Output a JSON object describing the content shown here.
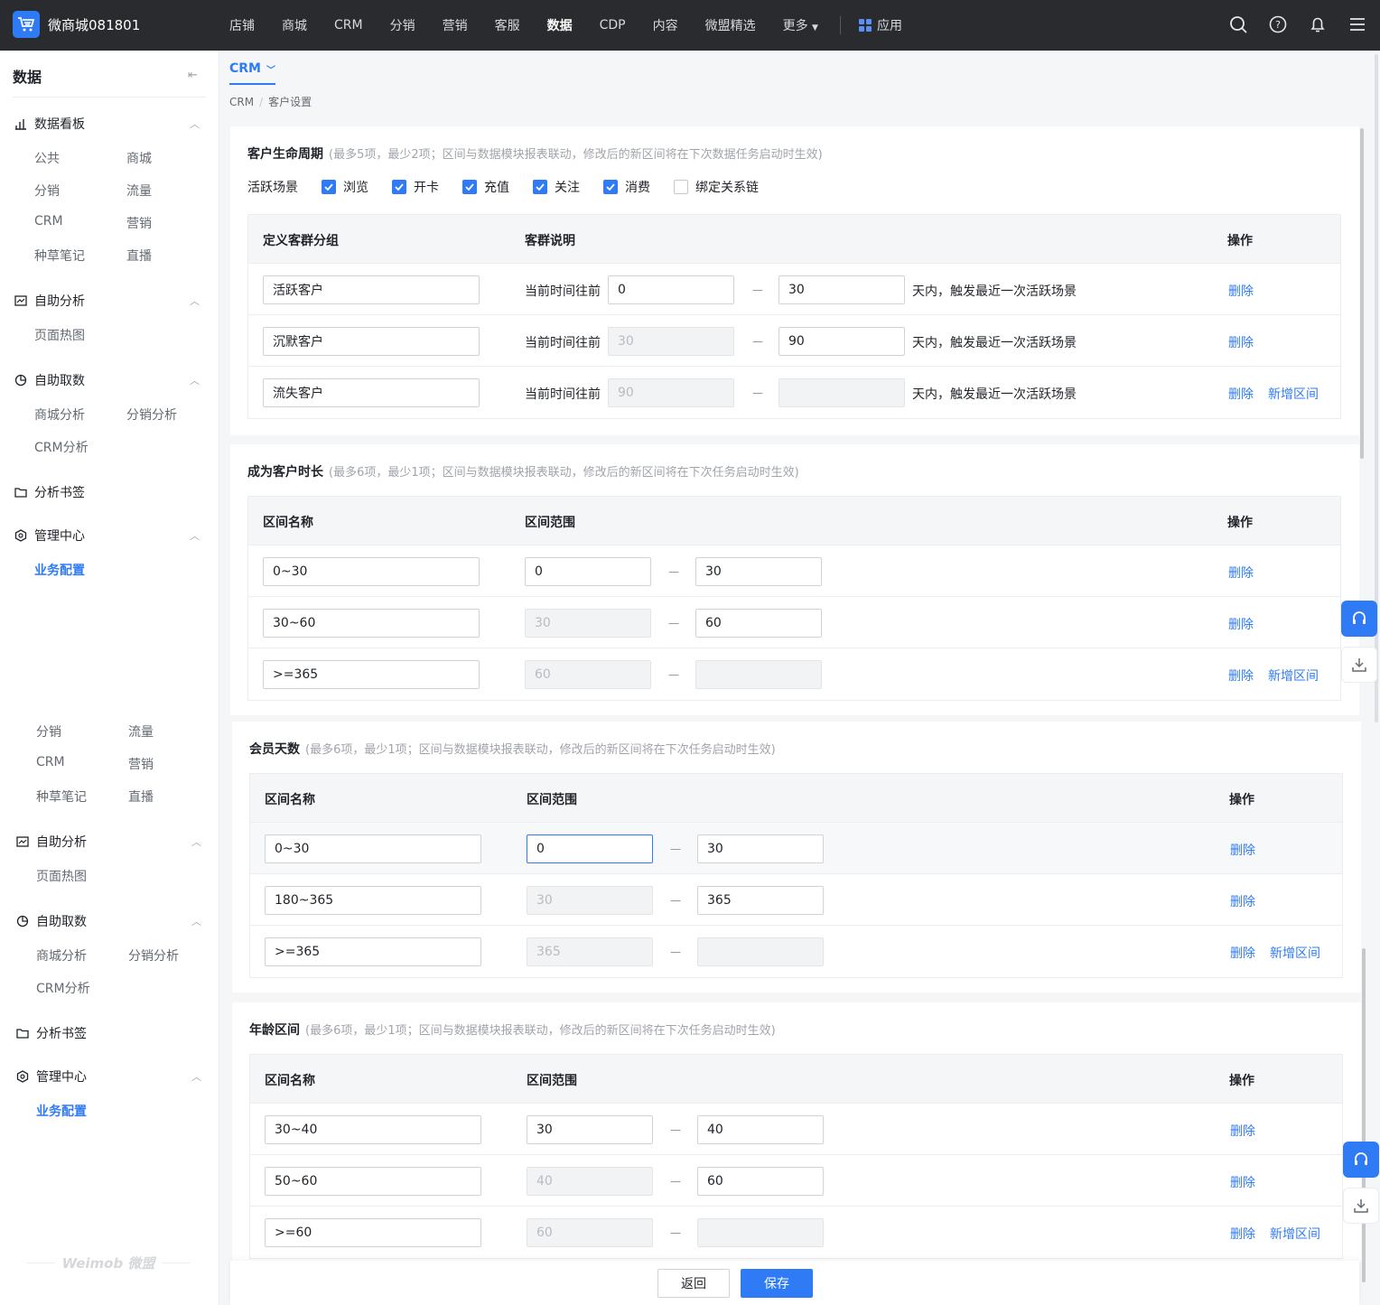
{
  "topbar": {
    "brand": "微商城081801",
    "nav": [
      "店铺",
      "商城",
      "CRM",
      "分销",
      "营销",
      "客服",
      "数据",
      "CDP",
      "内容",
      "微盟精选"
    ],
    "more": "更多",
    "apps": "应用",
    "active": "数据"
  },
  "sidebar": {
    "title": "数据",
    "dashboard": "数据看板",
    "dashboard_items": [
      "公共",
      "商城",
      "分销",
      "流量",
      "CRM",
      "营销",
      "种草笔记",
      "直播"
    ],
    "self_analysis": "自助分析",
    "heatmap": "页面热图",
    "self_fetch": "自助取数",
    "fetch_items": [
      "商城分析",
      "分销分析",
      "CRM分析"
    ],
    "bookmark": "分析书签",
    "manage": "管理中心",
    "biz_config": "业务配置",
    "watermark": "Weimob 微盟"
  },
  "header": {
    "tab": "CRM",
    "crumb_root": "CRM",
    "crumb_current": "客户设置"
  },
  "lifecycle": {
    "title": "客户生命周期",
    "hint": "(最多5项，最少2项；区间与数据模块报表联动，修改后的新区间将在下次数据任务启动时生效)",
    "scene_label": "活跃场景",
    "scenes": [
      {
        "label": "浏览",
        "checked": true
      },
      {
        "label": "开卡",
        "checked": true
      },
      {
        "label": "充值",
        "checked": true
      },
      {
        "label": "关注",
        "checked": true
      },
      {
        "label": "消费",
        "checked": true
      },
      {
        "label": "绑定关系链",
        "checked": false
      }
    ],
    "col1": "定义客群分组",
    "col2": "客群说明",
    "col3": "操作",
    "prefix": "当前时间往前",
    "suffix": "天内，触发最近一次活跃场景",
    "rows": [
      {
        "name": "活跃客户",
        "from": "0",
        "to": "30"
      },
      {
        "name": "沉默客户",
        "from": "30",
        "to": "90"
      },
      {
        "name": "流失客户",
        "from": "90",
        "to": ""
      }
    ]
  },
  "ops": {
    "delete": "删除",
    "add": "新增区间"
  },
  "tenure": {
    "title": "成为客户时长",
    "hint": "(最多6项，最少1项；区间与数据模块报表联动，修改后的新区间将在下次任务启动时生效)",
    "col1": "区间名称",
    "col2": "区间范围",
    "col3": "操作",
    "rows": [
      {
        "name": "0~30",
        "from": "0",
        "to": "30"
      },
      {
        "name": "30~60",
        "from": "30",
        "to": "60"
      },
      {
        "name": ">=365",
        "from": "60",
        "to": ""
      }
    ]
  },
  "member": {
    "title": "会员天数",
    "hint": "(最多6项，最少1项；区间与数据模块报表联动，修改后的新区间将在下次任务启动时生效)",
    "col1": "区间名称",
    "col2": "区间范围",
    "col3": "操作",
    "rows": [
      {
        "name": "0~30",
        "from": "0",
        "to": "30"
      },
      {
        "name": "180~365",
        "from": "30",
        "to": "365"
      },
      {
        "name": ">=365",
        "from": "365",
        "to": ""
      }
    ]
  },
  "age": {
    "title": "年龄区间",
    "hint": "(最多6项，最少1项；区间与数据模块报表联动，修改后的新区间将在下次任务启动时生效)",
    "col1": "区间名称",
    "col2": "区间范围",
    "col3": "操作",
    "rows": [
      {
        "name": "30~40",
        "from": "30",
        "to": "40"
      },
      {
        "name": "50~60",
        "from": "40",
        "to": "60"
      },
      {
        "name": ">=60",
        "from": "60",
        "to": ""
      }
    ]
  },
  "footer": {
    "back": "返回",
    "save": "保存"
  },
  "colors": {
    "accent": "#2f7bf5",
    "topbar": "#2a2b2e"
  }
}
